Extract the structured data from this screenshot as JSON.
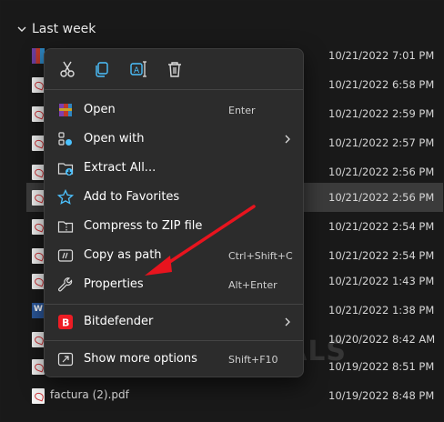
{
  "group": {
    "label": "Last week"
  },
  "files": [
    {
      "name": "",
      "date": "10/21/2022 7:01 PM",
      "icon": "zip-file-icon",
      "selected": false
    },
    {
      "name": "",
      "date": "10/21/2022 6:58 PM",
      "icon": "pdf-file-icon",
      "selected": false
    },
    {
      "name": "",
      "date": "10/21/2022 2:59 PM",
      "icon": "pdf-file-icon",
      "selected": false
    },
    {
      "name": "",
      "date": "10/21/2022 2:57 PM",
      "icon": "pdf-file-icon",
      "selected": false
    },
    {
      "name": "",
      "date": "10/21/2022 2:56 PM",
      "icon": "pdf-file-icon",
      "selected": false
    },
    {
      "name": "",
      "date": "10/21/2022 2:56 PM",
      "icon": "pdf-file-icon",
      "selected": true
    },
    {
      "name": "",
      "date": "10/21/2022 2:54 PM",
      "icon": "pdf-file-icon",
      "selected": false
    },
    {
      "name": "",
      "date": "10/21/2022 2:54 PM",
      "icon": "pdf-file-icon",
      "selected": false
    },
    {
      "name": "",
      "date": "10/21/2022 1:43 PM",
      "icon": "pdf-file-icon",
      "selected": false
    },
    {
      "name": "",
      "date": "10/21/2022 1:38 PM",
      "icon": "word-file-icon",
      "selected": false
    },
    {
      "name": "",
      "date": "10/20/2022 8:42 AM",
      "icon": "generic-file-icon",
      "selected": false
    },
    {
      "name": "",
      "date": "10/19/2022 8:51 PM",
      "icon": "pdf-file-icon",
      "selected": false
    },
    {
      "name": "factura (2).pdf",
      "date": "10/19/2022 8:48 PM",
      "icon": "pdf-file-icon",
      "selected": false
    }
  ],
  "context_menu": {
    "quick_actions": [
      "cut-icon",
      "copy-icon",
      "rename-icon",
      "delete-icon"
    ],
    "items": [
      {
        "label": "Open",
        "shortcut": "Enter",
        "icon": "winrar-icon",
        "submenu": false
      },
      {
        "label": "Open with",
        "shortcut": "",
        "icon": "open-with-icon",
        "submenu": true
      },
      {
        "label": "Extract All...",
        "shortcut": "",
        "icon": "extract-folder-icon",
        "submenu": false
      },
      {
        "label": "Add to Favorites",
        "shortcut": "",
        "icon": "star-icon",
        "submenu": false
      },
      {
        "label": "Compress to ZIP file",
        "shortcut": "",
        "icon": "zip-folder-icon",
        "submenu": false
      },
      {
        "label": "Copy as path",
        "shortcut": "Ctrl+Shift+C",
        "icon": "copy-path-icon",
        "submenu": false
      },
      {
        "label": "Properties",
        "shortcut": "Alt+Enter",
        "icon": "wrench-icon",
        "submenu": false
      },
      {
        "label": "Bitdefender",
        "shortcut": "",
        "icon": "bitdefender-icon",
        "submenu": true
      },
      {
        "label": "Show more options",
        "shortcut": "Shift+F10",
        "icon": "more-options-icon",
        "submenu": false
      }
    ]
  },
  "colors": {
    "background": "#191919",
    "menu": "#2c2c2c",
    "selected_row": "#3b3b3b",
    "arrow": "#e8141e",
    "accent": "#4cc2ff"
  },
  "watermark": "A PUALS"
}
